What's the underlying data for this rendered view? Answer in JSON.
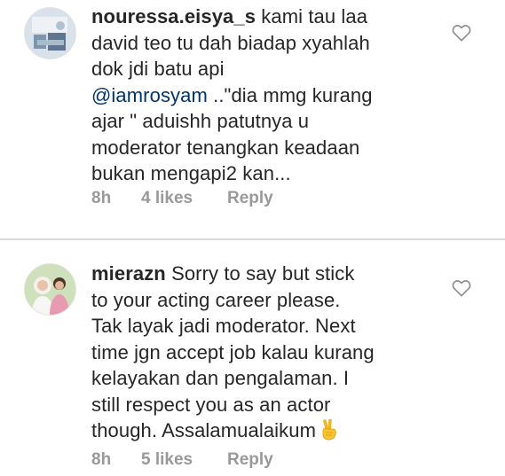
{
  "comments": [
    {
      "username": "nouressa.eisya_s",
      "lines": [
        " kami tau laa",
        "david teo tu dah biadap xyahlah",
        "dok jdi batu api",
        "@iamrosyam",
        " ..\"dia mmg kurang",
        "ajar \" aduishh patutnya u",
        "moderator tenangkan keadaan",
        "bukan mengapi2 kan..."
      ],
      "time": "8h",
      "likes": "4 likes",
      "reply": "Reply",
      "avatar_icon": "profile-photo-icon",
      "like_icon": "heart-outline-icon"
    },
    {
      "username": "mierazn",
      "lines": [
        " Sorry to say but stick",
        "to your acting career please.",
        "Tak layak jadi moderator. Next",
        "time jgn accept job kalau kurang",
        "kelayakan dan pengalaman. I",
        "still respect you as an actor",
        "though. Assalamualaikum"
      ],
      "emoji": "✌",
      "emoji_icon": "victory-hand-emoji",
      "time": "8h",
      "likes": "5 likes",
      "reply": "Reply",
      "avatar_icon": "profile-photo-icon",
      "like_icon": "heart-outline-icon"
    }
  ],
  "colors": {
    "text": "#262626",
    "meta": "#999999",
    "mention": "#003569",
    "divider": "#dbdbdb"
  }
}
